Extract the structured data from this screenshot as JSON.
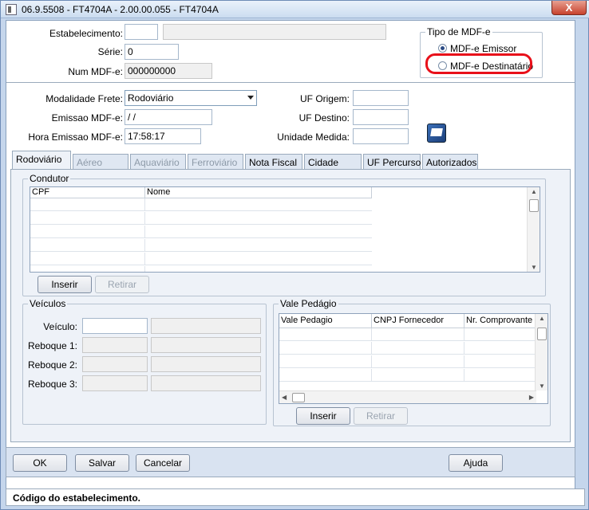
{
  "window": {
    "title": "06.9.5508 - FT4704A - 2.00.00.055 - FT4704A",
    "close_label": "X"
  },
  "header": {
    "estabelecimento_label": "Estabelecimento:",
    "estabelecimento_value": "",
    "estabelecimento_desc": "",
    "serie_label": "Série:",
    "serie_value": "0",
    "num_mdfe_label": "Num MDF-e:",
    "num_mdfe_value": "000000000"
  },
  "tipo_mdfe": {
    "legend": "Tipo de MDF-e",
    "options": [
      {
        "label": "MDF-e Emissor",
        "selected": true
      },
      {
        "label": "MDF-e Destinatário",
        "selected": false
      }
    ],
    "highlight_color": "#e8101a"
  },
  "transport": {
    "modalidade_label": "Modalidade Frete:",
    "modalidade_value": "Rodoviário",
    "emissao_label": "Emissao MDF-e:",
    "emissao_value": " / /",
    "hora_label": "Hora Emissao MDF-e:",
    "hora_value": "17:58:17",
    "uf_origem_label": "UF Origem:",
    "uf_origem_value": "",
    "uf_destino_label": "UF Destino:",
    "uf_destino_value": "",
    "unidade_label": "Unidade Medida:",
    "unidade_value": "",
    "book_icon": "book-icon"
  },
  "tabs": [
    {
      "label": "Rodoviário",
      "state": "active"
    },
    {
      "label": "Aéreo",
      "state": "disabled"
    },
    {
      "label": "Aquaviário",
      "state": "disabled"
    },
    {
      "label": "Ferroviário",
      "state": "disabled"
    },
    {
      "label": "Nota Fiscal",
      "state": "normal"
    },
    {
      "label": "Cidade",
      "state": "normal"
    },
    {
      "label": "UF Percurso",
      "state": "normal"
    },
    {
      "label": "Autorizados",
      "state": "normal"
    }
  ],
  "condutor": {
    "legend": "Condutor",
    "columns": [
      "CPF",
      "Nome"
    ],
    "inserir_label": "Inserir",
    "retirar_label": "Retirar"
  },
  "veiculos": {
    "legend": "Veículos",
    "veiculo_label": "Veículo:",
    "reboque1_label": "Reboque 1:",
    "reboque2_label": "Reboque 2:",
    "reboque3_label": "Reboque 3:"
  },
  "vale_pedagio": {
    "legend": "Vale Pedágio",
    "columns": [
      "Vale Pedagio",
      "CNPJ Fornecedor",
      "Nr. Comprovante"
    ],
    "inserir_label": "Inserir",
    "retirar_label": "Retirar"
  },
  "footer": {
    "ok_label": "OK",
    "salvar_label": "Salvar",
    "cancelar_label": "Cancelar",
    "ajuda_label": "Ajuda"
  },
  "status": {
    "text": "Código do estabelecimento."
  }
}
